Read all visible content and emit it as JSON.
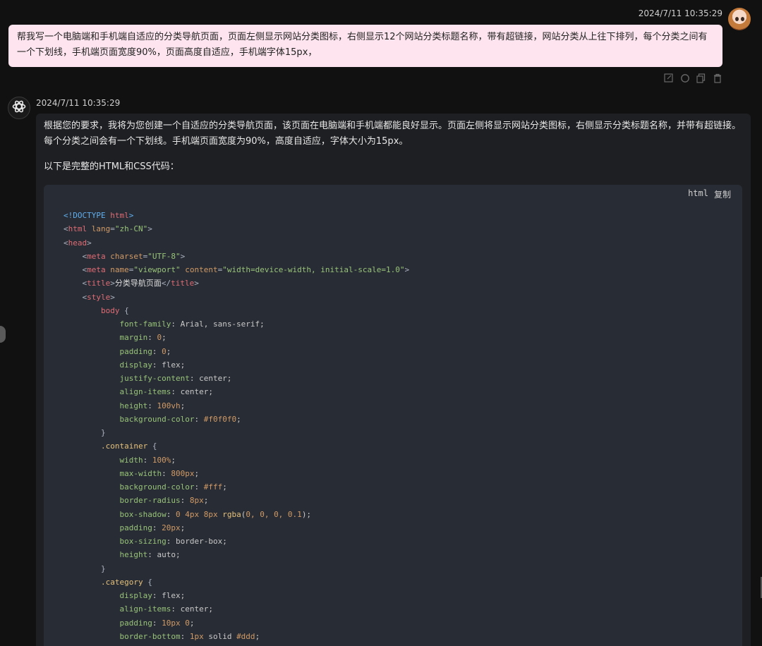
{
  "user_message": {
    "timestamp": "2024/7/11 10:35:29",
    "text": "帮我写一个电脑端和手机端自适应的分类导航页面，页面左侧显示网站分类图标，右侧显示12个网站分类标题名称，带有超链接，网站分类从上往下排列，每个分类之间有一个下划线，手机端页面宽度90%，页面高度自适应，手机端字体15px，",
    "avatar_icon": "anime-avatar",
    "actions": [
      "edit-icon",
      "regenerate-icon",
      "copy-icon",
      "delete-icon"
    ]
  },
  "assistant_message": {
    "timestamp": "2024/7/11 10:35:29",
    "avatar_icon": "openai-logo-icon",
    "paragraphs": [
      "根据您的要求，我将为您创建一个自适应的分类导航页面，该页面在电脑端和手机端都能良好显示。页面左侧将显示网站分类图标，右侧显示分类标题名称，并带有超链接。每个分类之间会有一个下划线。手机端页面宽度为90%，高度自适应，字体大小为15px。",
      "以下是完整的HTML和CSS代码："
    ]
  },
  "code_block": {
    "language": "html",
    "copy_label": "复制",
    "lines": [
      [
        {
          "t": "<!DOCTYPE ",
          "c": "doc"
        },
        {
          "t": "html",
          "c": "tag"
        },
        {
          "t": ">",
          "c": "doc"
        }
      ],
      [
        {
          "t": "<",
          "c": "p"
        },
        {
          "t": "html",
          "c": "tag"
        },
        {
          "t": " lang",
          "c": "attr"
        },
        {
          "t": "=",
          "c": "p"
        },
        {
          "t": "\"zh-CN\"",
          "c": "str"
        },
        {
          "t": ">",
          "c": "p"
        }
      ],
      [
        {
          "t": "<",
          "c": "p"
        },
        {
          "t": "head",
          "c": "tag"
        },
        {
          "t": ">",
          "c": "p"
        }
      ],
      [
        {
          "t": "    <",
          "c": "p"
        },
        {
          "t": "meta",
          "c": "tag"
        },
        {
          "t": " charset",
          "c": "attr"
        },
        {
          "t": "=",
          "c": "p"
        },
        {
          "t": "\"UTF-8\"",
          "c": "str"
        },
        {
          "t": ">",
          "c": "p"
        }
      ],
      [
        {
          "t": "    <",
          "c": "p"
        },
        {
          "t": "meta",
          "c": "tag"
        },
        {
          "t": " name",
          "c": "attr"
        },
        {
          "t": "=",
          "c": "p"
        },
        {
          "t": "\"viewport\"",
          "c": "str"
        },
        {
          "t": " content",
          "c": "attr"
        },
        {
          "t": "=",
          "c": "p"
        },
        {
          "t": "\"width=device-width, initial-scale=1.0\"",
          "c": "str"
        },
        {
          "t": ">",
          "c": "p"
        }
      ],
      [
        {
          "t": "    <",
          "c": "p"
        },
        {
          "t": "title",
          "c": "tag"
        },
        {
          "t": ">",
          "c": "p"
        },
        {
          "t": "分类导航页面",
          "c": "tx"
        },
        {
          "t": "</",
          "c": "p"
        },
        {
          "t": "title",
          "c": "tag"
        },
        {
          "t": ">",
          "c": "p"
        }
      ],
      [
        {
          "t": "    <",
          "c": "p"
        },
        {
          "t": "style",
          "c": "tag"
        },
        {
          "t": ">",
          "c": "p"
        }
      ],
      [
        {
          "t": "        ",
          "c": "p"
        },
        {
          "t": "body",
          "c": "tag"
        },
        {
          "t": " {",
          "c": "p"
        }
      ],
      [
        {
          "t": "            ",
          "c": "p"
        },
        {
          "t": "font-family",
          "c": "prop"
        },
        {
          "t": ": Arial, sans-serif;",
          "c": "val"
        }
      ],
      [
        {
          "t": "            ",
          "c": "p"
        },
        {
          "t": "margin",
          "c": "prop"
        },
        {
          "t": ": ",
          "c": "val"
        },
        {
          "t": "0",
          "c": "num"
        },
        {
          "t": ";",
          "c": "val"
        }
      ],
      [
        {
          "t": "            ",
          "c": "p"
        },
        {
          "t": "padding",
          "c": "prop"
        },
        {
          "t": ": ",
          "c": "val"
        },
        {
          "t": "0",
          "c": "num"
        },
        {
          "t": ";",
          "c": "val"
        }
      ],
      [
        {
          "t": "            ",
          "c": "p"
        },
        {
          "t": "display",
          "c": "prop"
        },
        {
          "t": ": flex;",
          "c": "val"
        }
      ],
      [
        {
          "t": "            ",
          "c": "p"
        },
        {
          "t": "justify-content",
          "c": "prop"
        },
        {
          "t": ": center;",
          "c": "val"
        }
      ],
      [
        {
          "t": "            ",
          "c": "p"
        },
        {
          "t": "align-items",
          "c": "prop"
        },
        {
          "t": ": center;",
          "c": "val"
        }
      ],
      [
        {
          "t": "            ",
          "c": "p"
        },
        {
          "t": "height",
          "c": "prop"
        },
        {
          "t": ": ",
          "c": "val"
        },
        {
          "t": "100vh",
          "c": "num"
        },
        {
          "t": ";",
          "c": "val"
        }
      ],
      [
        {
          "t": "            ",
          "c": "p"
        },
        {
          "t": "background-color",
          "c": "prop"
        },
        {
          "t": ": ",
          "c": "val"
        },
        {
          "t": "#f0f0f0",
          "c": "num"
        },
        {
          "t": ";",
          "c": "val"
        }
      ],
      [
        {
          "t": "        }",
          "c": "p"
        }
      ],
      [
        {
          "t": "        ",
          "c": "p"
        },
        {
          "t": ".container",
          "c": "sel"
        },
        {
          "t": " {",
          "c": "p"
        }
      ],
      [
        {
          "t": "            ",
          "c": "p"
        },
        {
          "t": "width",
          "c": "prop"
        },
        {
          "t": ": ",
          "c": "val"
        },
        {
          "t": "100%",
          "c": "num"
        },
        {
          "t": ";",
          "c": "val"
        }
      ],
      [
        {
          "t": "            ",
          "c": "p"
        },
        {
          "t": "max-width",
          "c": "prop"
        },
        {
          "t": ": ",
          "c": "val"
        },
        {
          "t": "800px",
          "c": "num"
        },
        {
          "t": ";",
          "c": "val"
        }
      ],
      [
        {
          "t": "            ",
          "c": "p"
        },
        {
          "t": "background-color",
          "c": "prop"
        },
        {
          "t": ": ",
          "c": "val"
        },
        {
          "t": "#fff",
          "c": "num"
        },
        {
          "t": ";",
          "c": "val"
        }
      ],
      [
        {
          "t": "            ",
          "c": "p"
        },
        {
          "t": "border-radius",
          "c": "prop"
        },
        {
          "t": ": ",
          "c": "val"
        },
        {
          "t": "8px",
          "c": "num"
        },
        {
          "t": ";",
          "c": "val"
        }
      ],
      [
        {
          "t": "            ",
          "c": "p"
        },
        {
          "t": "box-shadow",
          "c": "prop"
        },
        {
          "t": ": ",
          "c": "val"
        },
        {
          "t": "0 4px 8px ",
          "c": "num"
        },
        {
          "t": "rgba",
          "c": "key"
        },
        {
          "t": "(",
          "c": "val"
        },
        {
          "t": "0, 0, 0, 0.1",
          "c": "num"
        },
        {
          "t": ");",
          "c": "val"
        }
      ],
      [
        {
          "t": "            ",
          "c": "p"
        },
        {
          "t": "padding",
          "c": "prop"
        },
        {
          "t": ": ",
          "c": "val"
        },
        {
          "t": "20px",
          "c": "num"
        },
        {
          "t": ";",
          "c": "val"
        }
      ],
      [
        {
          "t": "            ",
          "c": "p"
        },
        {
          "t": "box-sizing",
          "c": "prop"
        },
        {
          "t": ": border-box;",
          "c": "val"
        }
      ],
      [
        {
          "t": "            ",
          "c": "p"
        },
        {
          "t": "height",
          "c": "prop"
        },
        {
          "t": ": auto;",
          "c": "val"
        }
      ],
      [
        {
          "t": "        }",
          "c": "p"
        }
      ],
      [
        {
          "t": "        ",
          "c": "p"
        },
        {
          "t": ".category",
          "c": "sel"
        },
        {
          "t": " {",
          "c": "p"
        }
      ],
      [
        {
          "t": "            ",
          "c": "p"
        },
        {
          "t": "display",
          "c": "prop"
        },
        {
          "t": ": flex;",
          "c": "val"
        }
      ],
      [
        {
          "t": "            ",
          "c": "p"
        },
        {
          "t": "align-items",
          "c": "prop"
        },
        {
          "t": ": center;",
          "c": "val"
        }
      ],
      [
        {
          "t": "            ",
          "c": "p"
        },
        {
          "t": "padding",
          "c": "prop"
        },
        {
          "t": ": ",
          "c": "val"
        },
        {
          "t": "10px 0",
          "c": "num"
        },
        {
          "t": ";",
          "c": "val"
        }
      ],
      [
        {
          "t": "            ",
          "c": "p"
        },
        {
          "t": "border-bottom",
          "c": "prop"
        },
        {
          "t": ": ",
          "c": "val"
        },
        {
          "t": "1px",
          "c": "num"
        },
        {
          "t": " solid ",
          "c": "val"
        },
        {
          "t": "#ddd",
          "c": "num"
        },
        {
          "t": ";",
          "c": "val"
        }
      ]
    ]
  }
}
